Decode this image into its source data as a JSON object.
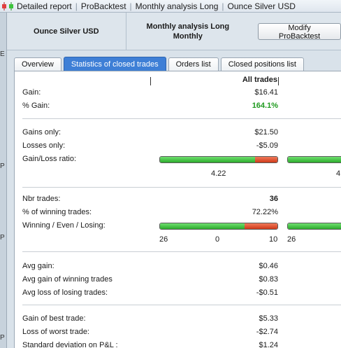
{
  "titlebar": {
    "crumbs": [
      "Detailed report",
      "ProBacktest",
      "Monthly analysis Long",
      "Ounce Silver USD"
    ]
  },
  "leftstrip": {
    "marks": [
      "E",
      "P",
      "P",
      "P"
    ]
  },
  "header": {
    "instrument": "Ounce Silver USD",
    "system_line1": "Monthly analysis Long",
    "system_line2": "Monthly",
    "modify_button": "Modify ProBacktest"
  },
  "tabs": [
    {
      "label": "Overview",
      "active": false
    },
    {
      "label": "Statistics of closed trades",
      "active": true
    },
    {
      "label": "Orders list",
      "active": false
    },
    {
      "label": "Closed positions list",
      "active": false
    }
  ],
  "table": {
    "column_header": "All trades",
    "gain_label": "Gain:",
    "gain_value": "$16.41",
    "pct_gain_label": "% Gain:",
    "pct_gain_value": "164.1%",
    "gains_only_label": "Gains only:",
    "gains_only_value": "$21.50",
    "losses_only_label": "Losses only:",
    "losses_only_value": "-$5.09",
    "gain_loss_ratio_label": "Gain/Loss ratio:",
    "gain_loss_ratio_value": "4.22",
    "gain_loss_ratio_next": "4",
    "gain_loss_fraction": 0.8085,
    "nbr_trades_label": "Nbr trades:",
    "nbr_trades_value": "36",
    "pct_winning_label": "% of winning trades:",
    "pct_winning_value": "72.22%",
    "wel_label": "Winning / Even / Losing:",
    "winning_count": "26",
    "even_count": "0",
    "losing_count": "10",
    "winning_next": "26",
    "winning_fraction": 0.7222,
    "avg_gain_label": "Avg gain:",
    "avg_gain_value": "$0.46",
    "avg_win_label": "Avg gain of winning trades",
    "avg_win_value": "$0.83",
    "avg_loss_label": "Avg loss of losing trades:",
    "avg_loss_value": "-$0.51",
    "best_label": "Gain of best trade:",
    "best_value": "$5.33",
    "worst_label": "Loss of worst trade:",
    "worst_value": "-$2.74",
    "stddev_label": "Standard deviation on P&L :",
    "stddev_value": "$1.24"
  },
  "colors": {
    "accent": "#3e7fd6",
    "positive": "#1e9a1e",
    "bar_green": "#2dab2d",
    "bar_red": "#cf3a1a"
  }
}
